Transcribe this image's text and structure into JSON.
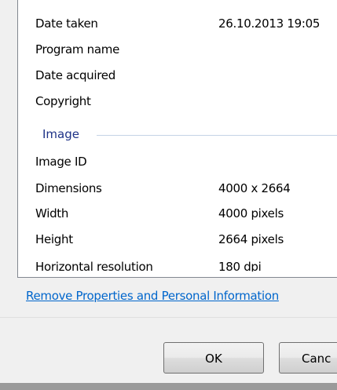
{
  "properties": {
    "rows_top": [
      {
        "label": "Date taken",
        "value": "26.10.2013 19:05"
      },
      {
        "label": "Program name",
        "value": ""
      },
      {
        "label": "Date acquired",
        "value": ""
      },
      {
        "label": "Copyright",
        "value": ""
      }
    ],
    "group_image": "Image",
    "rows_image": [
      {
        "label": "Image ID",
        "value": ""
      },
      {
        "label": "Dimensions",
        "value": "4000 x 2664"
      },
      {
        "label": "Width",
        "value": "4000 pixels"
      },
      {
        "label": "Height",
        "value": "2664 pixels"
      },
      {
        "label": "Horizontal resolution",
        "value": "180 dpi"
      }
    ]
  },
  "link": {
    "remove_properties": "Remove Properties and Personal Information"
  },
  "buttons": {
    "ok": "OK",
    "cancel": "Canc"
  },
  "colors": {
    "group_header": "#1e3287",
    "link": "#0066cc"
  }
}
